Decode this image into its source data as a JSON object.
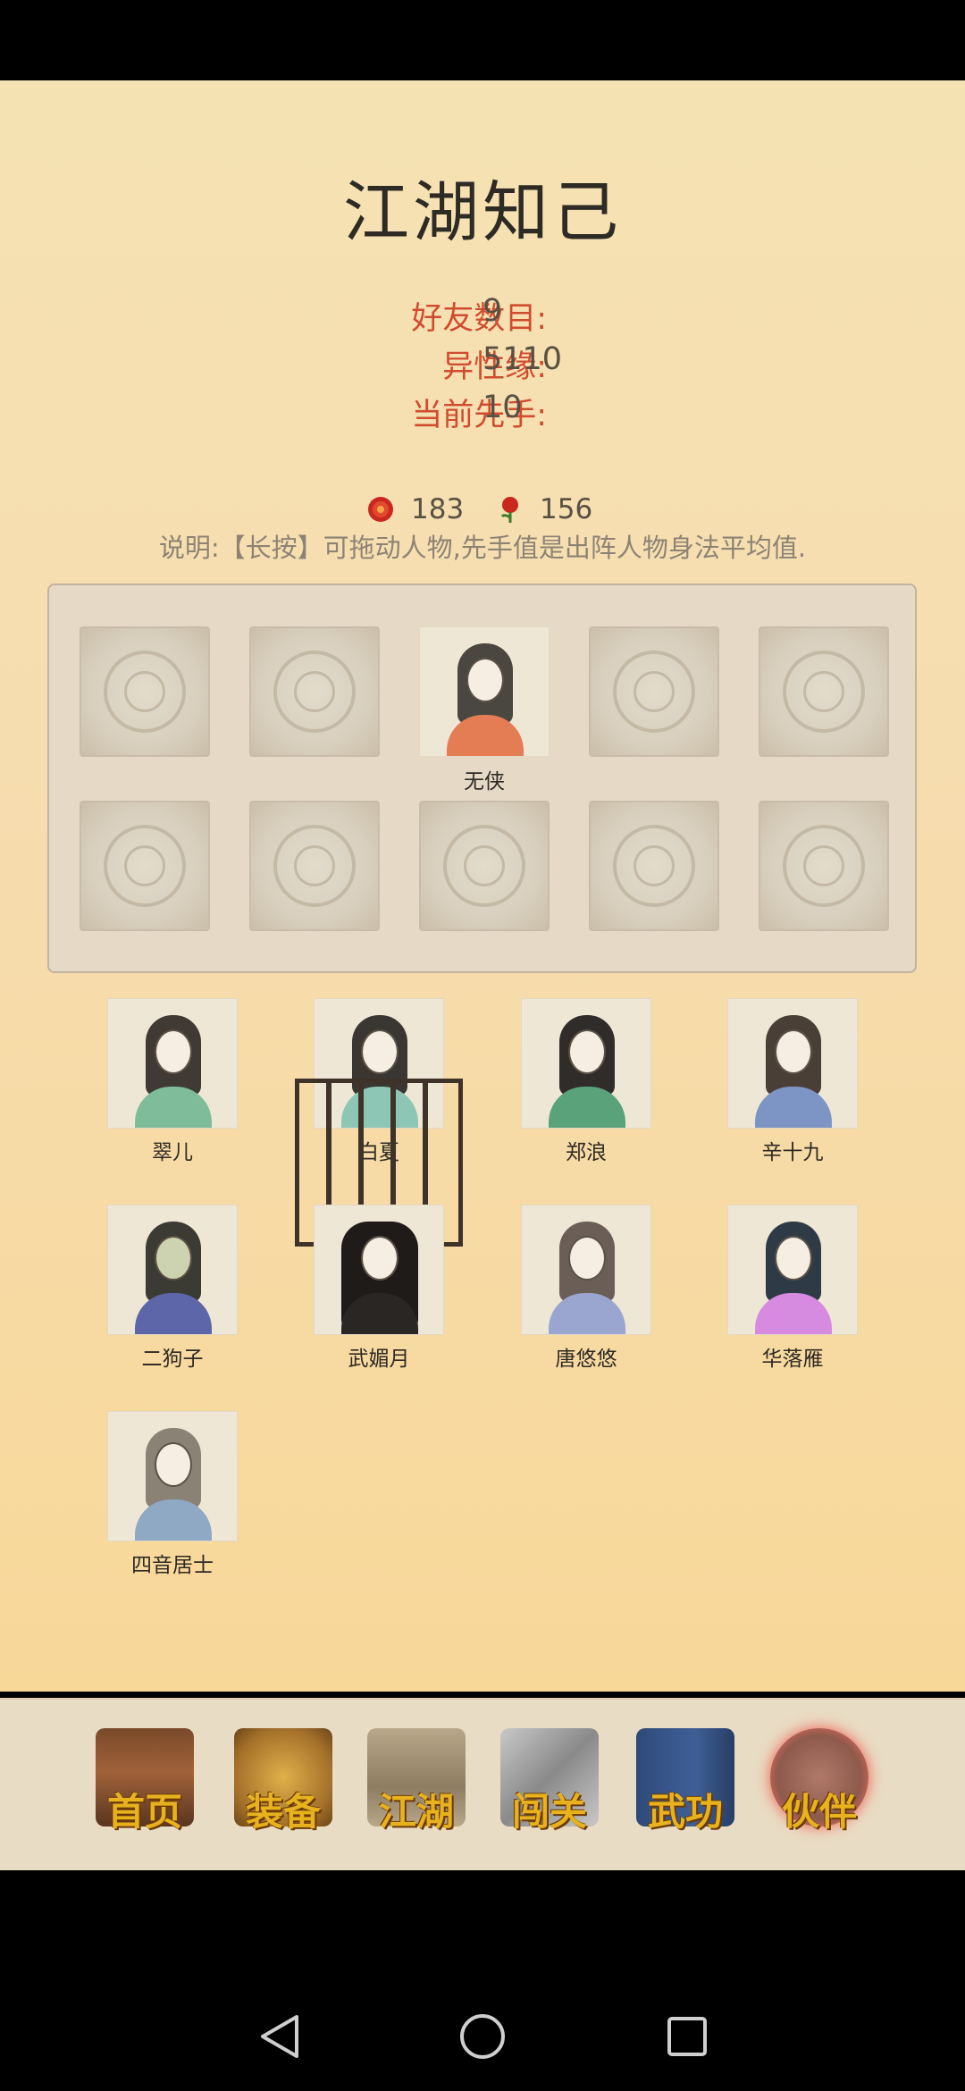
{
  "title": "江湖知己",
  "stats": [
    {
      "label": "好友数目:",
      "value": "9"
    },
    {
      "label": "异性缘:",
      "value": "5110"
    },
    {
      "label": "当前先手:",
      "value": "10"
    }
  ],
  "currency": [
    {
      "icon": "red-orb-icon",
      "value": "183"
    },
    {
      "icon": "rose-icon",
      "value": "156"
    }
  ],
  "note": "说明:【长按】可拖动人物,先手值是出阵人物身法平均值.",
  "formation": {
    "slots": [
      {
        "name": ""
      },
      {
        "name": ""
      },
      {
        "name": "无侠"
      },
      {
        "name": ""
      },
      {
        "name": ""
      },
      {
        "name": ""
      },
      {
        "name": ""
      },
      {
        "name": ""
      },
      {
        "name": ""
      },
      {
        "name": ""
      }
    ]
  },
  "characters": [
    {
      "name": "翠儿",
      "locked": false
    },
    {
      "name": "白夏",
      "locked": true
    },
    {
      "name": "郑浪",
      "locked": false
    },
    {
      "name": "辛十九",
      "locked": false
    },
    {
      "name": "二狗子",
      "locked": false
    },
    {
      "name": "武媚月",
      "locked": false
    },
    {
      "name": "唐悠悠",
      "locked": false
    },
    {
      "name": "华落雁",
      "locked": false
    },
    {
      "name": "四音居士",
      "locked": false
    }
  ],
  "nav": [
    {
      "label": "首页",
      "icon": "temple-icon"
    },
    {
      "label": "装备",
      "icon": "armor-icon"
    },
    {
      "label": "江湖",
      "icon": "scroll-map-icon"
    },
    {
      "label": "闯关",
      "icon": "crossed-swords-icon"
    },
    {
      "label": "武功",
      "icon": "book-icon"
    },
    {
      "label": "伙伴",
      "icon": "companions-icon",
      "active": true
    }
  ]
}
